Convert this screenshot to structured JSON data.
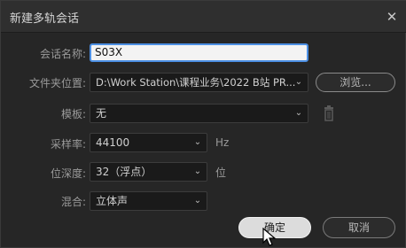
{
  "window": {
    "title": "新建多轨会话",
    "close_icon": "close-icon"
  },
  "form": {
    "session_name": {
      "label": "会话名称:",
      "value": "S03X"
    },
    "folder_location": {
      "label": "文件夹位置:",
      "value": "D:\\Work Station\\课程业务\\2022 B站 PR..."
    },
    "template": {
      "label": "模板:",
      "value": "无"
    },
    "sample_rate": {
      "label": "采样率:",
      "value": "44100",
      "unit": "Hz"
    },
    "bit_depth": {
      "label": "位深度:",
      "value": "32（浮点）",
      "unit": "位"
    },
    "mix": {
      "label": "混合:",
      "value": "立体声"
    }
  },
  "buttons": {
    "browse": "浏览...",
    "ok": "确定",
    "cancel": "取消"
  },
  "colors": {
    "accent_focus": "#4c8fe3",
    "background": "#262626"
  }
}
